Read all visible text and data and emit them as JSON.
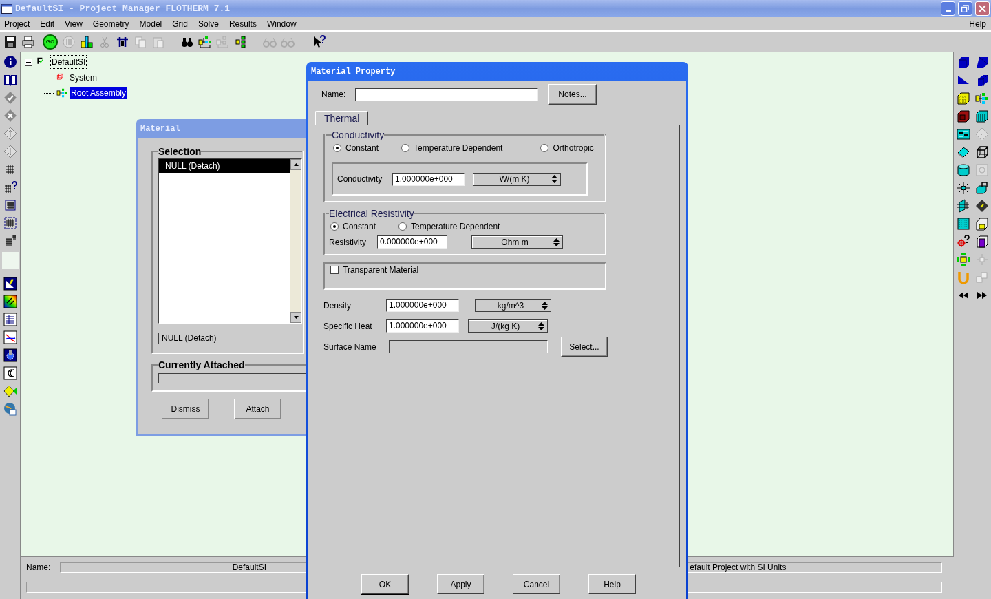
{
  "window": {
    "title": "DefaultSI - Project Manager FLOTHERM 7.1"
  },
  "menu": [
    "Project",
    "Edit",
    "View",
    "Geometry",
    "Model",
    "Grid",
    "Solve",
    "Results",
    "Window"
  ],
  "help_menu": "Help",
  "toolbar": {
    "go_label": "GO"
  },
  "tree": {
    "label": "DefaultSI",
    "expanded": true,
    "selected": false,
    "children": [
      {
        "label": "System",
        "kind": "system",
        "selected": false
      },
      {
        "label": "Root Assembly",
        "kind": "assembly",
        "selected": true
      }
    ]
  },
  "material_dialog": {
    "title": "Material",
    "selection_group": "Selection",
    "list": [
      {
        "label": "NULL (Detach)",
        "selected": true
      }
    ],
    "selection_field": "NULL (Detach)",
    "attached_group": "Currently Attached",
    "buttons": [
      "Dismiss",
      "Attach"
    ]
  },
  "property_dialog": {
    "title": "Material Property",
    "name_label": "Name:",
    "notes_button": "Notes...",
    "tabs": [
      {
        "label": "Thermal",
        "selected": true
      }
    ],
    "conductivity": {
      "title": "Conductivity",
      "options": [
        {
          "label": "Constant",
          "selected": true
        },
        {
          "label": "Temperature Dependent",
          "selected": false
        },
        {
          "label": "Orthotropic",
          "selected": false
        }
      ],
      "label": "Conductivity",
      "value": "1.000000e+000",
      "unit": "W/(m K)"
    },
    "resistivity": {
      "title": "Electrical Resistivity",
      "options": [
        {
          "label": "Constant",
          "selected": true
        },
        {
          "label": "Temperature Dependent",
          "selected": false
        }
      ],
      "label": "Resistivity",
      "value": "0.000000e+000",
      "unit": "Ohm m"
    },
    "transparent": {
      "label": "Transparent Material",
      "checked": false
    },
    "fields": [
      {
        "label": "Density",
        "value": "1.000000e+000",
        "unit": "kg/m^3"
      },
      {
        "label": "Specific Heat",
        "value": "1.000000e+000",
        "unit": "J/(kg K)"
      }
    ],
    "surface": {
      "label": "Surface Name",
      "button": "Select..."
    },
    "buttons": [
      "OK",
      "Apply",
      "Cancel",
      "Help"
    ]
  },
  "status": {
    "name_label": "Name:",
    "name_value": "DefaultSI",
    "description": "efault Project with SI Units"
  }
}
